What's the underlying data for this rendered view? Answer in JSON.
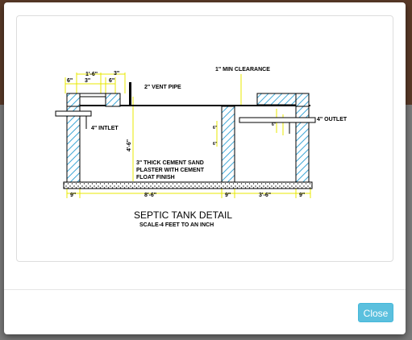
{
  "modal": {
    "close_label": "Close"
  },
  "drawing": {
    "title": "SEPTIC TANK DETAIL",
    "scale": "SCALE-4 FEET TO AN INCH",
    "vent_pipe": "2\" VENT PIPE",
    "clearance": "1\" MIN CLEARANCE",
    "inlet": "4\" INTLET",
    "outlet": "4\" OUTLET",
    "plaster_1": "3\" THICK CEMENT SAND",
    "plaster_2": "PLASTER WITH CEMENT",
    "plaster_3": "FLOAT FINISH",
    "dim_top_1": "1'-6\"",
    "dim_top_2": "3\"",
    "dim_top_3": "3\"",
    "dim_top_4": "6\"",
    "dim_top_5": "6\"",
    "dim_height": "4'-6\"",
    "dim_small_1": "6\"",
    "dim_small_2": "6\"",
    "dim_small_3": "6\"",
    "dim_bot_1": "9\"",
    "dim_bot_2": "8'-6\"",
    "dim_bot_3": "9\"",
    "dim_bot_4": "3'-6\"",
    "dim_bot_5": "9\""
  },
  "colors": {
    "dimension": "#e8e800",
    "hatch": "#3fa7d6",
    "line": "#000000",
    "accent_button": "#5bc0de"
  }
}
